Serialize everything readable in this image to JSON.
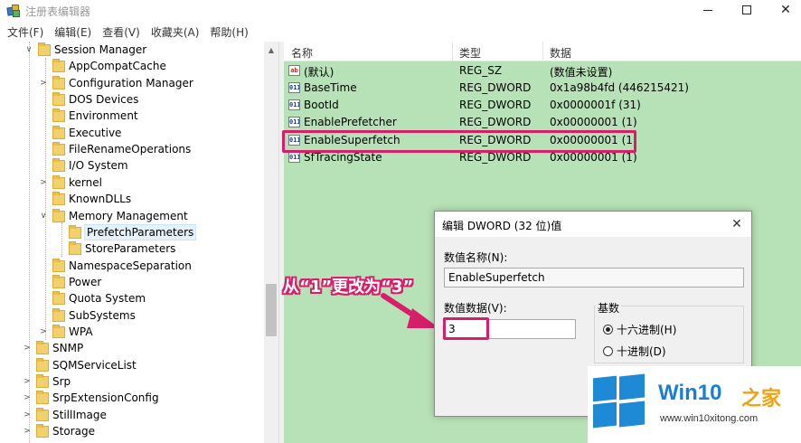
{
  "window": {
    "title": "注册表编辑器",
    "minimize_glyph": "",
    "maximize_glyph": "",
    "close_glyph": "✕"
  },
  "menu": [
    "文件(F)",
    "编辑(E)",
    "查看(V)",
    "收藏夹(A)",
    "帮助(H)"
  ],
  "tree": {
    "items": [
      {
        "label": "Session Manager",
        "expander": "∨"
      },
      {
        "label": "AppCompatCache",
        "expander": ""
      },
      {
        "label": "Configuration Manager",
        "expander": ">"
      },
      {
        "label": "DOS Devices",
        "expander": ""
      },
      {
        "label": "Environment",
        "expander": ""
      },
      {
        "label": "Executive",
        "expander": ""
      },
      {
        "label": "FileRenameOperations",
        "expander": ""
      },
      {
        "label": "I/O System",
        "expander": ""
      },
      {
        "label": "kernel",
        "expander": ">"
      },
      {
        "label": "KnownDLLs",
        "expander": ""
      },
      {
        "label": "Memory Management",
        "expander": "∨"
      },
      {
        "label": "PrefetchParameters",
        "expander": ""
      },
      {
        "label": "StoreParameters",
        "expander": ""
      },
      {
        "label": "NamespaceSeparation",
        "expander": ""
      },
      {
        "label": "Power",
        "expander": ""
      },
      {
        "label": "Quota System",
        "expander": ""
      },
      {
        "label": "SubSystems",
        "expander": ""
      },
      {
        "label": "WPA",
        "expander": ">"
      },
      {
        "label": "SNMP",
        "expander": ">"
      },
      {
        "label": "SQMServiceList",
        "expander": ""
      },
      {
        "label": "Srp",
        "expander": ">"
      },
      {
        "label": "SrpExtensionConfig",
        "expander": ">"
      },
      {
        "label": "StillImage",
        "expander": ">"
      },
      {
        "label": "Storage",
        "expander": ">"
      }
    ],
    "scroll_up_glyph": "▲"
  },
  "list": {
    "columns": [
      "名称",
      "类型",
      "数据"
    ],
    "rows": [
      {
        "name": "(默认)",
        "type": "REG_SZ",
        "data": "(数值未设置)",
        "icon": "ab"
      },
      {
        "name": "BaseTime",
        "type": "REG_DWORD",
        "data": "0x1a98b4fd (446215421)",
        "icon": "011"
      },
      {
        "name": "BootId",
        "type": "REG_DWORD",
        "data": "0x0000001f (31)",
        "icon": "011"
      },
      {
        "name": "EnablePrefetcher",
        "type": "REG_DWORD",
        "data": "0x00000001 (1)",
        "icon": "011"
      },
      {
        "name": "EnableSuperfetch",
        "type": "REG_DWORD",
        "data": "0x00000001 (1)",
        "icon": "011"
      },
      {
        "name": "SfTracingState",
        "type": "REG_DWORD",
        "data": "0x00000001 (1)",
        "icon": "011"
      }
    ]
  },
  "dialog": {
    "title": "编辑 DWORD (32 位)值",
    "close_glyph": "✕",
    "name_label": "数值名称(N):",
    "name_value": "EnableSuperfetch",
    "data_label": "数值数据(V):",
    "data_value": "3",
    "base_label": "基数",
    "radio_hex": "十六进制(H)",
    "radio_dec": "十进制(D)",
    "selected_base": "hex"
  },
  "annotation": "从“1”更改为“3”",
  "colors": {
    "accent": "#d81e6a",
    "list_background": "#b7e2b7",
    "watermark_blue": "#1a7fd0",
    "watermark_orange": "#f3a20f"
  },
  "watermark": {
    "brand": "Win10",
    "suffix": "之家",
    "url": "www.win10xitong.com"
  }
}
